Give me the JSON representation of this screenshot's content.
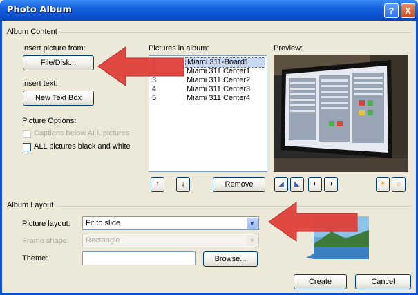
{
  "window": {
    "title": "Photo Album",
    "help_symbol": "?",
    "close_symbol": "X",
    "title_color": "#0b4fd1"
  },
  "album_content": {
    "group_label": "Album Content",
    "insert_picture_label": "Insert picture from:",
    "file_disk_button": "File/Disk...",
    "insert_text_label": "Insert text:",
    "new_text_box_button": "New Text Box",
    "picture_options_label": "Picture Options:",
    "captions_checkbox": "Captions below ALL pictures",
    "captions_checked": false,
    "captions_enabled": false,
    "bw_checkbox": "ALL pictures black and white",
    "bw_checked": false,
    "pictures_label": "Pictures in album:",
    "pictures": [
      {
        "number": "1",
        "name": "Miami 311-Board1",
        "selected": true
      },
      {
        "number": "2",
        "name": "Miami 311 Center1",
        "selected": false
      },
      {
        "number": "3",
        "name": "Miami 311 Center2",
        "selected": false
      },
      {
        "number": "4",
        "name": "Miami 311 Center3",
        "selected": false
      },
      {
        "number": "5",
        "name": "Miami 311 Center4",
        "selected": false
      }
    ],
    "preview_label": "Preview:",
    "move_up_icon": "arrow-up-icon",
    "move_down_icon": "arrow-down-icon",
    "remove_button": "Remove",
    "rotate_left_icon": "rotate-left-icon",
    "rotate_right_icon": "rotate-right-icon",
    "contrast_up_icon": "contrast-up-icon",
    "contrast_down_icon": "contrast-down-icon",
    "brightness_up_icon": "brightness-up-icon",
    "brightness_down_icon": "brightness-down-icon"
  },
  "album_layout": {
    "group_label": "Album Layout",
    "picture_layout_label": "Picture layout:",
    "picture_layout_value": "Fit to slide",
    "frame_shape_label": "Frame shape:",
    "frame_shape_value": "Rectangle",
    "frame_shape_enabled": false,
    "theme_label": "Theme:",
    "theme_value": "",
    "browse_button": "Browse..."
  },
  "footer": {
    "create_button": "Create",
    "cancel_button": "Cancel"
  },
  "annotations": {
    "arrow_color": "#e0403a"
  }
}
